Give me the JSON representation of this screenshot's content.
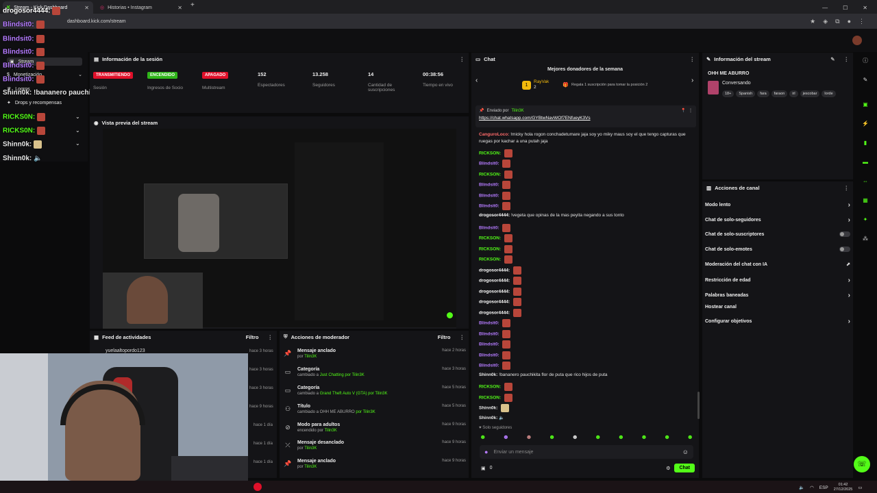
{
  "browser": {
    "tabs": [
      {
        "title": "Stream - Kick Dashboard",
        "active": true
      },
      {
        "title": "Historias • Instagram",
        "active": false
      }
    ],
    "url": "dashboard.kick.com/stream"
  },
  "overlay_chat": [
    {
      "user": "drogosor4444:",
      "color": "#ffffff"
    },
    {
      "user": "Blindsit0:",
      "color": "#b57bff"
    },
    {
      "user": "Blindsit0:",
      "color": "#b57bff"
    },
    {
      "user": "Blindsit0:",
      "color": "#b57bff"
    },
    {
      "user": "Blindsit0:",
      "color": "#b57bff"
    },
    {
      "user": "Blindsit0:",
      "color": "#b57bff"
    },
    {
      "user": "Shinn0k:",
      "color": "#e8e8e8",
      "text": "!bananero pauchikita flor de puta que rico hijos de puta"
    },
    {
      "user": "RICKS0N:",
      "color": "#53fc18"
    },
    {
      "user": "RICKS0N:",
      "color": "#53fc18"
    },
    {
      "user": "Shinn0k:",
      "color": "#e8e8e8"
    },
    {
      "user": "Shinn0k:",
      "color": "#e8e8e8"
    }
  ],
  "sidebar": {
    "items": [
      {
        "label": "Stream",
        "chevron": false
      },
      {
        "label": "Monetización",
        "chevron": true
      },
      {
        "label": "Logros",
        "chevron": false
      },
      {
        "label": "Drops y recompensas",
        "chevron": false
      }
    ]
  },
  "session": {
    "title": "Información de la sesión",
    "badges": [
      {
        "text": "TRANSMITIENDO",
        "label": "Sesión",
        "color": "#e0102a"
      },
      {
        "text": "ENCENDIDO",
        "label": "Ingresos de Socio",
        "color": "#2fb51a"
      },
      {
        "text": "APAGADO",
        "label": "Multistream",
        "color": "#e0102a"
      }
    ],
    "stats": [
      {
        "value": "152",
        "label": "Espectadores"
      },
      {
        "value": "13.258",
        "label": "Seguidores"
      },
      {
        "value": "14",
        "label": "Cantidad de suscripciones"
      },
      {
        "value": "00:38:56",
        "label": "Tiempo en vivo"
      }
    ]
  },
  "preview": {
    "title": "Vista previa del stream"
  },
  "activity": {
    "title": "Feed de actividades",
    "filter": "Filtro",
    "rows": [
      {
        "user": "yuelaaltopordo123",
        "time": "hace 3 horas"
      },
      {
        "user": "",
        "time": "hace 3 horas"
      },
      {
        "user": "",
        "time": "hace 3 horas"
      },
      {
        "user": "",
        "time": "hace 9 horas"
      },
      {
        "user": "",
        "time": "hace 1 día"
      },
      {
        "user": "",
        "time": "hace 1 día"
      },
      {
        "user": "",
        "time": "hace 1 día"
      }
    ]
  },
  "mod_actions": {
    "title": "Acciones de moderador",
    "filter": "Filtro",
    "rows": [
      {
        "icon": "pin-icon",
        "title": "Mensaje anclado",
        "pre": "por",
        "value": "Tilin3K",
        "time": "hace 2 horas"
      },
      {
        "icon": "category-icon",
        "title": "Categoría",
        "pre": "cambiado a",
        "value": "Just Chatting por Tilin3K",
        "time": "hace 3 horas"
      },
      {
        "icon": "category-icon",
        "title": "Categoría",
        "pre": "cambiado a",
        "value": "Grand Theft Auto V (GTA) por Tilin3K",
        "time": "hace 5 horas"
      },
      {
        "icon": "title-icon",
        "title": "Título",
        "pre": "cambiado a OHH ME ABURRO",
        "value": "por Tilin3K",
        "time": "hace 5 horas"
      },
      {
        "icon": "adult-icon",
        "title": "Modo para adultos",
        "pre": "encendido por",
        "value": "Tilin3K",
        "time": "hace 9 horas"
      },
      {
        "icon": "unpin-icon",
        "title": "Mensaje desanclado",
        "pre": "por",
        "value": "Tilin3K",
        "time": "hace 9 horas"
      },
      {
        "icon": "pin-icon",
        "title": "Mensaje anclado",
        "pre": "por",
        "value": "Tilin3K",
        "time": "hace 9 horas"
      }
    ]
  },
  "chat": {
    "title": "Chat",
    "donors_title": "Mejores donadores de la semana",
    "donor_name": "RayVak",
    "donor_rank": "2",
    "donor_hint": "Regala 1 suscripción para tomar la posición 2",
    "pinned_label": "Enviado por",
    "pinned_by": "Tilin3K",
    "pinned_link": "https://chat.whatsapp.com/GYBtwNavWOf7ENfueyK3Vs",
    "lines": [
      {
        "user": "CanguroLoco:",
        "color": "#ff6b6b",
        "text": "!micky hola rogon conchadetumare jaja soy yo miky maus soy el que tengo capturas que ruegas por kachar a una putah jaja"
      },
      {
        "user": "RICKSON:",
        "color": "#53fc18",
        "text": "",
        "emote": true
      },
      {
        "user": "Blindsit0:",
        "color": "#b57bff",
        "text": "",
        "emote": true
      },
      {
        "user": "RICKSON:",
        "color": "#53fc18",
        "text": "",
        "emote": true
      },
      {
        "user": "Blindsit0:",
        "color": "#b57bff",
        "text": "",
        "emote": true
      },
      {
        "user": "Blindsit0:",
        "color": "#b57bff",
        "text": "",
        "emote": true
      },
      {
        "user": "Blindsit0:",
        "color": "#b57bff",
        "text": "",
        "emote": true
      },
      {
        "user": "drogosor4444:",
        "color": "#ffffff",
        "text": "!vegeta que opinas de la mas peyita negando a sus tonto"
      },
      {
        "user": "Blindsit0:",
        "color": "#b57bff",
        "text": "",
        "emote": true
      },
      {
        "user": "RICKSON:",
        "color": "#53fc18",
        "text": "",
        "emote": true
      },
      {
        "user": "RICKSON:",
        "color": "#53fc18",
        "text": "",
        "emote": true
      },
      {
        "user": "RICKSON:",
        "color": "#53fc18",
        "text": "",
        "emote": true
      },
      {
        "user": "drogosor4444:",
        "color": "#ffffff",
        "text": "",
        "emote": true
      },
      {
        "user": "drogosor4444:",
        "color": "#ffffff",
        "text": "",
        "emote": true
      },
      {
        "user": "drogosor4444:",
        "color": "#ffffff",
        "text": "",
        "emote": true
      },
      {
        "user": "drogosor4444:",
        "color": "#ffffff",
        "text": "",
        "emote": true
      },
      {
        "user": "drogosor4444:",
        "color": "#ffffff",
        "text": "",
        "emote": true
      },
      {
        "user": "Blindsit0:",
        "color": "#b57bff",
        "text": "",
        "emote": true
      },
      {
        "user": "Blindsit0:",
        "color": "#b57bff",
        "text": "",
        "emote": true
      },
      {
        "user": "Blindsit0:",
        "color": "#b57bff",
        "text": "",
        "emote": true
      },
      {
        "user": "Blindsit0:",
        "color": "#b57bff",
        "text": "",
        "emote": true
      },
      {
        "user": "Blindsit0:",
        "color": "#b57bff",
        "text": "",
        "emote": true
      },
      {
        "user": "Shinn0k:",
        "color": "#e8e8e8",
        "text": "!bananero pauchikita flor de puta que rico hijos de puta"
      },
      {
        "user": "RICKSON:",
        "color": "#53fc18",
        "text": "",
        "emote": true
      },
      {
        "user": "RICKSON:",
        "color": "#53fc18",
        "text": "",
        "emote": true
      },
      {
        "user": "Shinn0k:",
        "color": "#e8e8e8",
        "text": "",
        "emote": true
      },
      {
        "user": "Shinn0k:",
        "color": "#e8e8e8",
        "text": "🔈"
      }
    ],
    "followers_only": "Solo seguidores",
    "input_placeholder": "Enviar un mensaje",
    "count": "0",
    "send_label": "Chat"
  },
  "stream_info": {
    "title": "Información del stream",
    "stream_title": "OHH ME ABURRO",
    "category": "Conversando",
    "tags": [
      "18+",
      "Spanish",
      "fara",
      "faraon",
      "irl",
      "jescobar",
      "lorde"
    ]
  },
  "channel_actions": {
    "title": "Acciones de canal",
    "rows": [
      {
        "label": "Modo lento",
        "control": "chevron"
      },
      {
        "label": "Chat de solo-seguidores",
        "control": "chevron"
      },
      {
        "label": "Chat de solo-suscriptores",
        "control": "toggle"
      },
      {
        "label": "Chat de solo-emotes",
        "control": "toggle"
      },
      {
        "label": "Moderación del chat con IA",
        "control": "external"
      },
      {
        "label": "Restricción de edad",
        "control": "chevron"
      },
      {
        "label": "Palabras baneadas",
        "control": "chevron"
      },
      {
        "label": "Hostear canal",
        "control": "none"
      },
      {
        "label": "Configurar objetivos",
        "control": "chevron"
      }
    ]
  },
  "taskbar": {
    "lang": "ESP",
    "time": "01:42",
    "date": "27/12/2025"
  },
  "colors": {
    "accent": "#53fc18",
    "live_red": "#e0102a",
    "panel": "#141417"
  }
}
